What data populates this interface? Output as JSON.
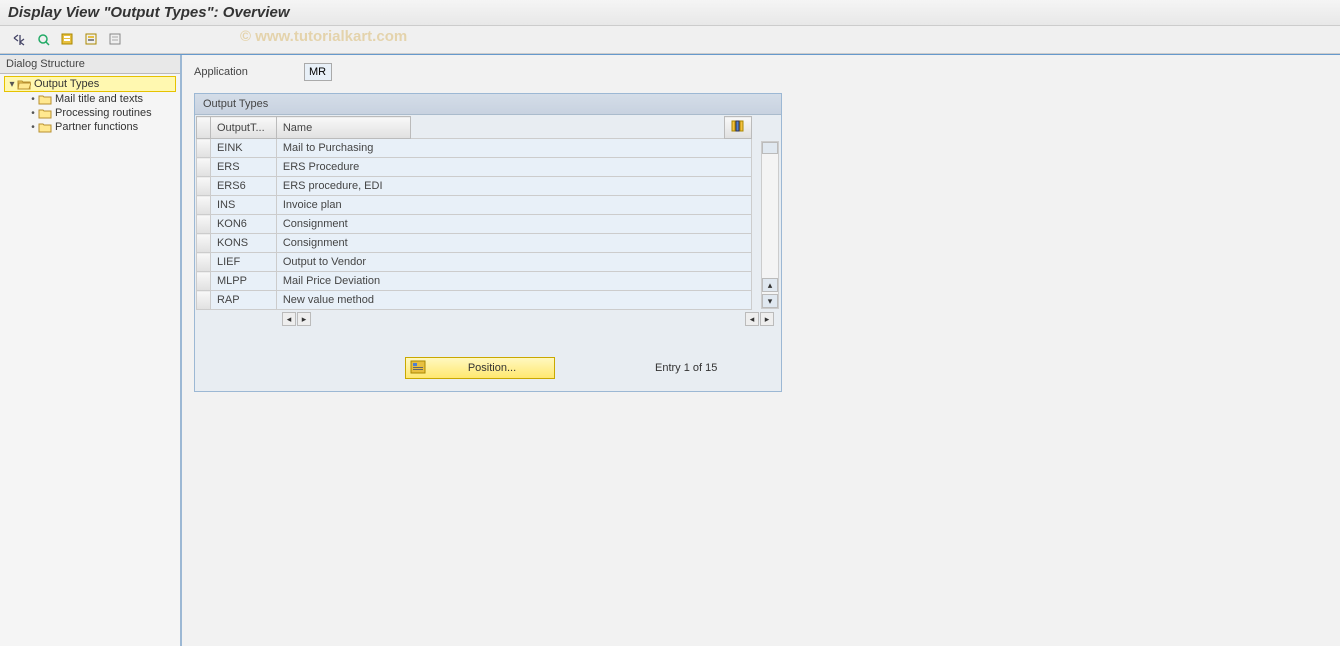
{
  "title": "Display View \"Output Types\": Overview",
  "watermark": "© www.tutorialkart.com",
  "dialog_structure": {
    "header": "Dialog Structure",
    "root": {
      "label": "Output Types"
    },
    "children": [
      {
        "label": "Mail title and texts"
      },
      {
        "label": "Processing routines"
      },
      {
        "label": "Partner functions"
      }
    ]
  },
  "application": {
    "label": "Application",
    "value": "MR"
  },
  "output_types": {
    "title": "Output Types",
    "columns": {
      "code": "OutputT...",
      "name": "Name"
    },
    "rows": [
      {
        "code": "EINK",
        "name": "Mail to Purchasing"
      },
      {
        "code": "ERS",
        "name": "ERS Procedure"
      },
      {
        "code": "ERS6",
        "name": "ERS procedure, EDI"
      },
      {
        "code": "INS",
        "name": "Invoice plan"
      },
      {
        "code": "KON6",
        "name": "Consignment"
      },
      {
        "code": "KONS",
        "name": "Consignment"
      },
      {
        "code": "LIEF",
        "name": "Output to Vendor"
      },
      {
        "code": "MLPP",
        "name": "Mail Price Deviation"
      },
      {
        "code": "RAP",
        "name": "New value method"
      }
    ]
  },
  "position_button": "Position...",
  "entry_text": "Entry 1 of 15"
}
